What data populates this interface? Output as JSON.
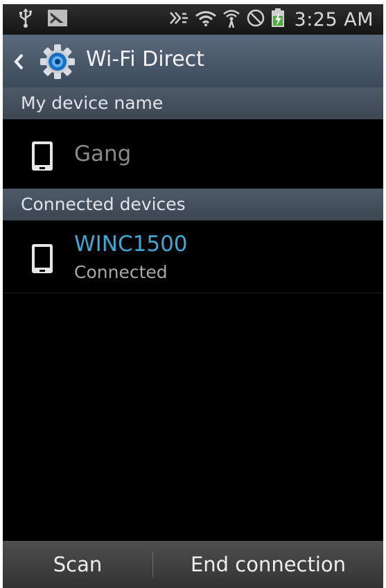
{
  "status_bar": {
    "time": "3:25 AM",
    "icons": [
      "usb-icon",
      "notification-icon",
      "nfc-icon",
      "wifi-icon",
      "wifi-direct-icon",
      "no-signal-icon",
      "battery-charging-icon"
    ]
  },
  "action_bar": {
    "title": "Wi-Fi Direct",
    "back_icon": "chevron-left-icon",
    "app_icon": "settings-gear-icon"
  },
  "sections": {
    "my_device": {
      "header": "My device name",
      "device_name": "Gang"
    },
    "connected": {
      "header": "Connected devices",
      "devices": [
        {
          "name": "WINC1500",
          "status": "Connected"
        }
      ]
    }
  },
  "bottom_bar": {
    "scan_label": "Scan",
    "end_connection_label": "End connection"
  },
  "colors": {
    "accent": "#3aa9d6",
    "header_bg": "#465260",
    "action_bar_bg": "#4b596a"
  }
}
